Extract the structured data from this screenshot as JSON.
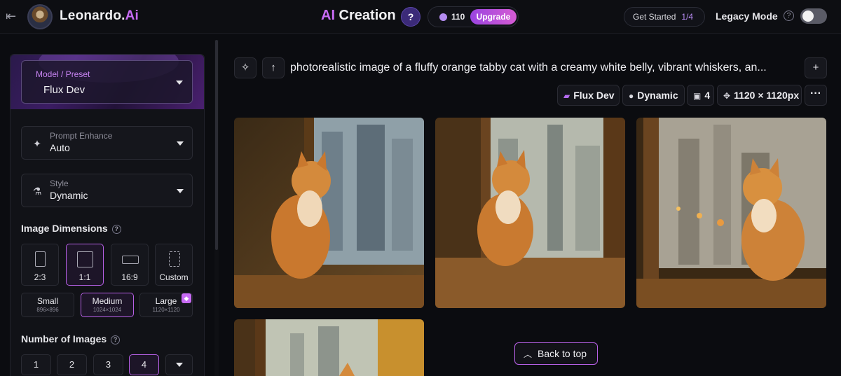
{
  "header": {
    "brand_name": "Leonardo.",
    "brand_suffix": "Ai",
    "page_title_prefix": "AI",
    "page_title_rest": " Creation",
    "help_label": "?",
    "token_count": "110",
    "upgrade_label": "Upgrade",
    "get_started_label": "Get Started",
    "get_started_step": "1/4",
    "legacy_mode_label": "Legacy Mode",
    "legacy_mode_help": "?",
    "legacy_mode_enabled": false
  },
  "sidebar": {
    "model": {
      "label": "Model / Preset",
      "value": "Flux Dev"
    },
    "prompt_enhance": {
      "label": "Prompt Enhance",
      "value": "Auto",
      "icon": "sparkles-icon"
    },
    "style": {
      "label": "Style",
      "value": "Dynamic",
      "icon": "flask-icon"
    },
    "image_dimensions": {
      "title": "Image Dimensions",
      "ratios": [
        {
          "label": "2:3",
          "active": false
        },
        {
          "label": "1:1",
          "active": true
        },
        {
          "label": "16:9",
          "active": false
        },
        {
          "label": "Custom",
          "active": false
        }
      ],
      "sizes": [
        {
          "name": "Small",
          "dims": "896×896",
          "active": false
        },
        {
          "name": "Medium",
          "dims": "1024×1024",
          "active": true
        },
        {
          "name": "Large",
          "dims": "1120×1120",
          "active": false,
          "premium": true
        }
      ]
    },
    "number_of_images": {
      "title": "Number of Images",
      "options": [
        "1",
        "2",
        "3",
        "4"
      ],
      "selected": "4"
    }
  },
  "main": {
    "prompt": "photorealistic image of a fluffy orange tabby cat with a creamy white belly, vibrant whiskers, an...",
    "chips": {
      "model": "Flux Dev",
      "style": "Dynamic",
      "count": "4",
      "dimensions": "1120 × 1120px"
    },
    "back_to_top_label": "Back to top"
  },
  "colors": {
    "accent": "#c86bf5",
    "accent_border": "#b760e6",
    "background": "#0b0c10"
  }
}
